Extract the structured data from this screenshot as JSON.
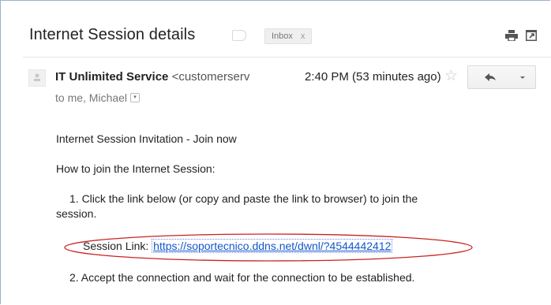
{
  "header": {
    "subject": "Internet Session details",
    "label": "Inbox",
    "label_close": "x"
  },
  "message": {
    "sender_name": "IT Unlimited Service",
    "sender_email_partial": "<customerserv",
    "time": "2:40 PM (53 minutes ago)",
    "recipients": "to me, Michael"
  },
  "body": {
    "invite_line": "Internet Session Invitation - Join now",
    "howto_line": "How to join the Internet Session:",
    "step1_line1": "1. Click the link below (or copy and paste the link to browser) to join the",
    "step1_line2": "session.",
    "link_label": "Session Link: ",
    "link_url": "https://soportecnico.ddns.net/dwnl/?4544442412",
    "step2_line": "2. Accept the connection and wait for the connection to be established."
  },
  "icons": {
    "print": "print-icon",
    "new_window": "new-window-icon",
    "star": "star-icon",
    "reply": "reply-icon",
    "more": "chevron-down-icon",
    "avatar": "avatar-icon",
    "label_tag": "label-tag-icon"
  },
  "colors": {
    "link": "#1155cc",
    "annotation_ellipse": "#cc2222",
    "frame_border": "#9bb0d0"
  }
}
